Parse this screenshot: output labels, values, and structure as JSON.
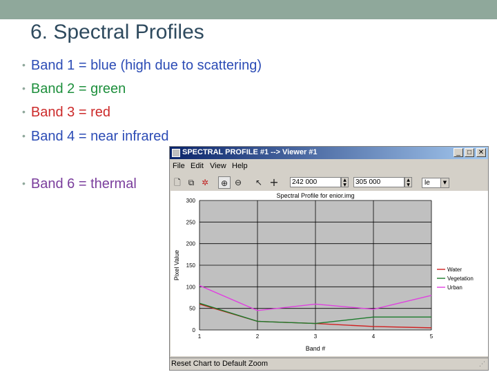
{
  "slide": {
    "title": "6. Spectral Profiles",
    "bullets": [
      {
        "text": "Band 1 = blue (high due to scattering)",
        "color": "#2b4bb5"
      },
      {
        "text": "Band 2 = green",
        "color": "#1d8f3c"
      },
      {
        "text": "Band 3 = red",
        "color": "#cc2a2a"
      },
      {
        "text": "Band 4 = near infrared",
        "color": "#2b4bb5"
      },
      {
        "text": "Band 6 = thermal",
        "color": "#7a3d9c"
      }
    ]
  },
  "window": {
    "title": "SPECTRAL PROFILE #1 --> Viewer #1",
    "controls": {
      "minimize": "_",
      "maximize": "□",
      "close": "✕"
    },
    "menu": [
      "File",
      "Edit",
      "View",
      "Help"
    ],
    "toolbar": {
      "icons": [
        "new-icon",
        "copy-icon",
        "options-icon",
        "zoom-in-icon",
        "zoom-out-icon",
        "pointer-icon",
        "crosshair-icon"
      ],
      "field1": "242 000",
      "field2": "305 000",
      "combo": "le"
    },
    "status": "Reset Chart to Default Zoom"
  },
  "chart_data": {
    "type": "line",
    "title": "Spectral Profile for enior.img",
    "xlabel": "Band #",
    "ylabel": "Pixel Value",
    "xlim": [
      1,
      5
    ],
    "ylim": [
      0,
      300
    ],
    "xticks": [
      "1",
      "2",
      "3",
      "4",
      "5"
    ],
    "yticks": [
      "0",
      "50",
      "100",
      "150",
      "200",
      "250",
      "300"
    ],
    "grid": true,
    "legend": "right",
    "series": [
      {
        "name": "Water",
        "color": "#d02020",
        "x": [
          1,
          2,
          3,
          4,
          5
        ],
        "y": [
          60,
          20,
          15,
          8,
          5
        ]
      },
      {
        "name": "Vegetation",
        "color": "#1a7a2a",
        "x": [
          1,
          2,
          3,
          4,
          5
        ],
        "y": [
          62,
          20,
          15,
          30,
          30
        ]
      },
      {
        "name": "Urban",
        "color": "#e040e0",
        "x": [
          1,
          2,
          3,
          4,
          5
        ],
        "y": [
          103,
          45,
          60,
          48,
          80
        ]
      }
    ]
  }
}
